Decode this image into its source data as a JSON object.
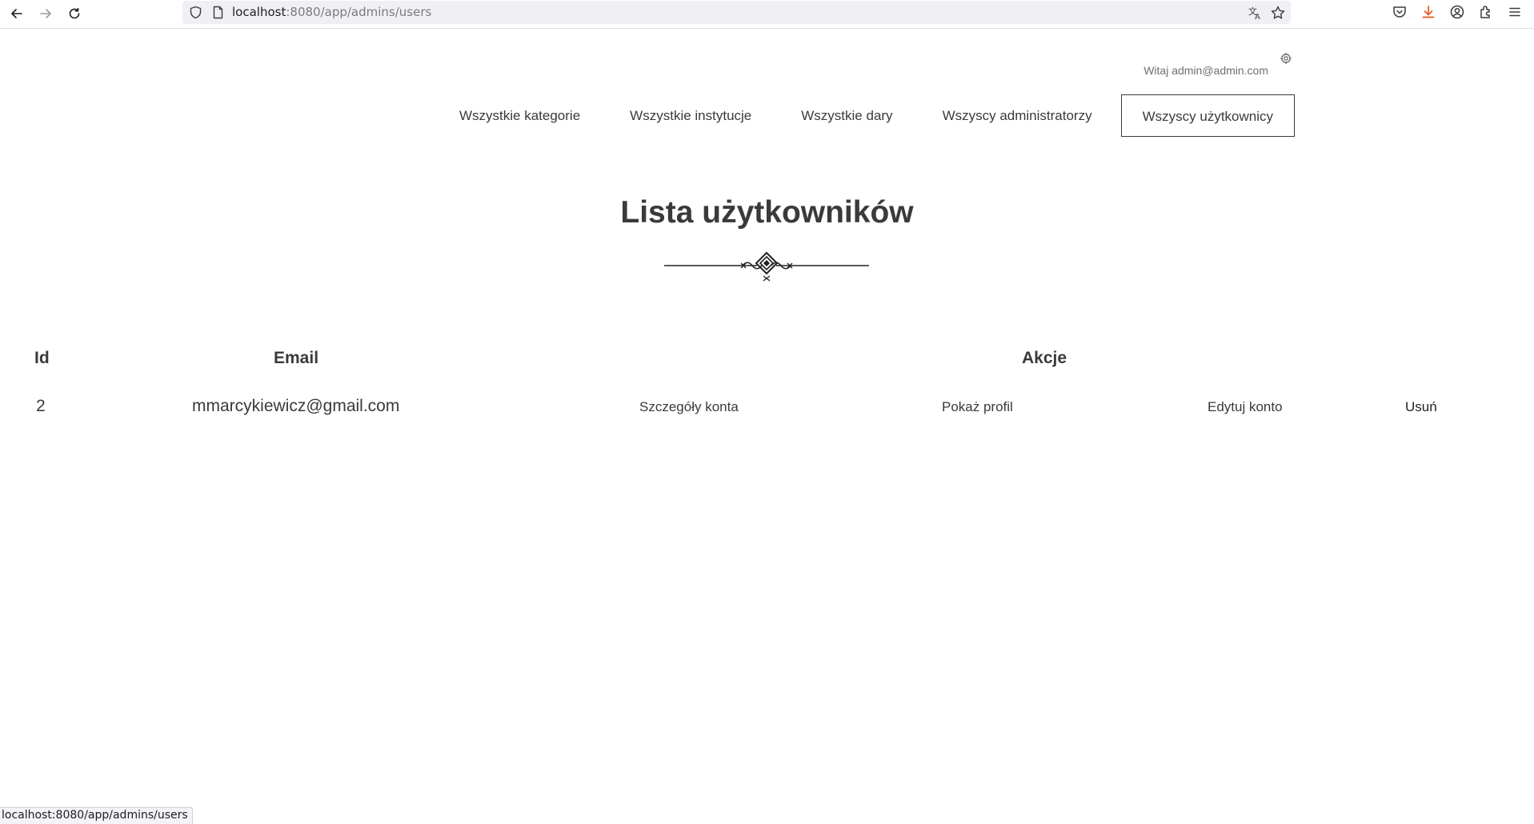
{
  "browser": {
    "url_host": "localhost",
    "url_path": ":8080/app/admins/users",
    "status_url": "localhost:8080/app/admins/users",
    "icons": {
      "back": "arrow-left-icon",
      "forward": "arrow-right-icon",
      "reload": "reload-icon",
      "shield": "shield-icon",
      "page": "page-icon",
      "translate": "translate-icon",
      "bookmark": "star-icon",
      "pocket": "pocket-icon",
      "downloads": "download-icon",
      "account": "account-icon",
      "extensions": "extensions-icon",
      "menu": "hamburger-menu-icon"
    },
    "download_accent": "#e25920"
  },
  "header": {
    "greeting": "Witaj admin@admin.com",
    "settings_icon": "gear-icon"
  },
  "nav": {
    "items": [
      {
        "label": "Wszystkie kategorie",
        "active": false
      },
      {
        "label": "Wszystkie instytucje",
        "active": false
      },
      {
        "label": "Wszystkie dary",
        "active": false
      },
      {
        "label": "Wszyscy administratorzy",
        "active": false
      },
      {
        "label": "Wszyscy użytkownicy",
        "active": true
      }
    ]
  },
  "main": {
    "title": "Lista użytkowników",
    "ornament_icon": "decorative-divider-icon"
  },
  "table": {
    "headers": {
      "id": "Id",
      "email": "Email",
      "actions": "Akcje"
    },
    "rows": [
      {
        "id": "2",
        "email": "mmarcykiewicz@gmail.com",
        "details": "Szczegóły konta",
        "profile": "Pokaż profil",
        "edit": "Edytuj konto",
        "delete": "Usuń"
      }
    ]
  }
}
